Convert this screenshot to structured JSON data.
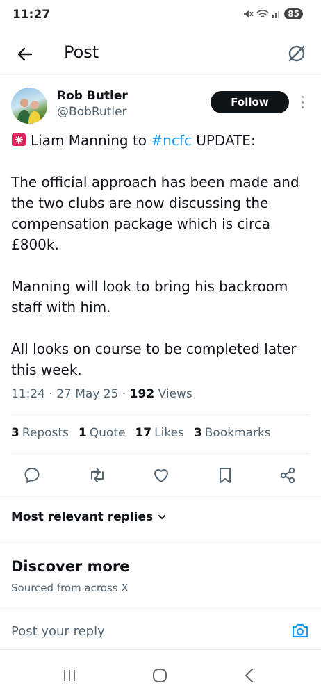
{
  "status_bar": {
    "time": "11:27",
    "battery": "85"
  },
  "header": {
    "title": "Post"
  },
  "author": {
    "name": "Rob Butler",
    "handle": "@BobRutler",
    "follow_label": "Follow"
  },
  "tweet": {
    "line1_prefix": "Liam Manning to ",
    "hashtag": "#ncfc",
    "line1_suffix": " UPDATE:",
    "paragraph2": "The official approach has been made and the two clubs are now discussing the compensation package which is circa £800k.",
    "paragraph3": "Manning will look to bring his backroom staff with him.",
    "paragraph4": "All looks on course to be completed later this week.",
    "emoji_icon": "siren-icon",
    "time": "11:24",
    "date": "27 May 25",
    "views_count": "192",
    "views_label": "Views"
  },
  "stats": {
    "reposts_count": "3",
    "reposts_label": "Reposts",
    "quotes_count": "1",
    "quotes_label": "Quote",
    "likes_count": "17",
    "likes_label": "Likes",
    "bookmarks_count": "3",
    "bookmarks_label": "Bookmarks"
  },
  "actions": [
    "reply-icon",
    "repost-icon",
    "like-icon",
    "bookmark-icon",
    "share-icon"
  ],
  "replies": {
    "sort_label": "Most relevant replies"
  },
  "discover": {
    "title": "Discover more",
    "subtitle": "Sourced from across X"
  },
  "reply_input": {
    "placeholder": "Post your reply"
  },
  "colors": {
    "accent": "#1d9bf0",
    "text": "#0f1419",
    "secondary": "#536471",
    "follow_bg": "#0f1419"
  }
}
